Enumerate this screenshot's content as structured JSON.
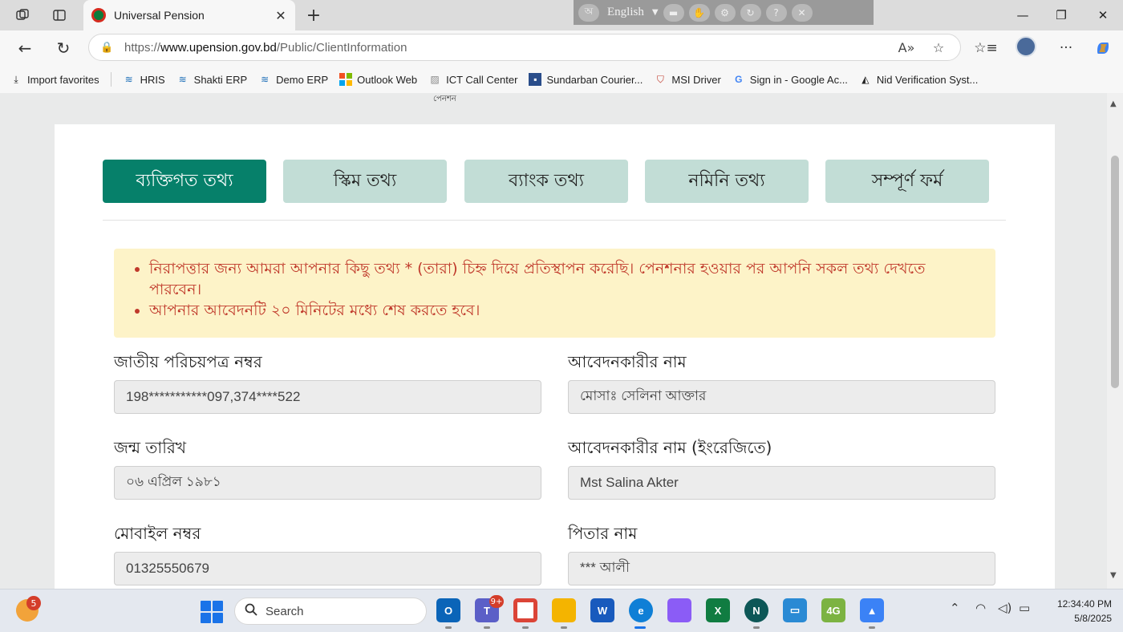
{
  "browser": {
    "tab_title": "Universal Pension",
    "url_host": "www.upension.gov.bd",
    "url_prefix": "https://",
    "url_path": "/Public/ClientInformation",
    "language_toolbar": {
      "language": "English"
    }
  },
  "favorites": [
    {
      "label": "Import favorites",
      "icon": "import-icon"
    },
    {
      "label": "HRIS",
      "icon": "hris-icon"
    },
    {
      "label": "Shakti ERP",
      "icon": "shakti-icon"
    },
    {
      "label": "Demo ERP",
      "icon": "demo-erp-icon"
    },
    {
      "label": "Outlook Web",
      "icon": "microsoft-icon"
    },
    {
      "label": "ICT Call Center",
      "icon": "ict-icon"
    },
    {
      "label": "Sundarban Courier...",
      "icon": "sundarban-icon"
    },
    {
      "label": "MSI Driver",
      "icon": "msi-icon"
    },
    {
      "label": "Sign in - Google Ac...",
      "icon": "google-icon"
    },
    {
      "label": "Nid Verification Syst...",
      "icon": "angular-icon"
    }
  ],
  "page": {
    "top_label": "পেনশন",
    "steps": [
      {
        "label": "ব্যক্তিগত তথ্য",
        "active": true
      },
      {
        "label": "স্কিম তথ্য",
        "active": false
      },
      {
        "label": "ব্যাংক তথ্য",
        "active": false
      },
      {
        "label": "নমিনি তথ্য",
        "active": false
      },
      {
        "label": "সম্পূর্ণ ফর্ম",
        "active": false
      }
    ],
    "notices": [
      "নিরাপত্তার জন্য আমরা আপনার কিছু তথ্য * (তারা) চিহ্ন দিয়ে প্রতিস্থাপন করেছি। পেনশনার হওয়ার পর আপনি সকল তথ্য দেখতে পারবেন।",
      "আপনার আবেদনটি ২০ মিনিটের মধ্যে শেষ করতে হবে।"
    ],
    "fields": {
      "nid": {
        "label": "জাতীয় পরিচয়পত্র নম্বর",
        "value": "198***********097,374****522"
      },
      "applicant_name": {
        "label": "আবেদনকারীর নাম",
        "value": "মোসাঃ সেলিনা আক্তার"
      },
      "dob": {
        "label": "জন্ম তারিখ",
        "value": "০৬ এপ্রিল ১৯৮১"
      },
      "applicant_name_en": {
        "label": "আবেদনকারীর নাম (ইংরেজিতে)",
        "value": "Mst Salina Akter"
      },
      "mobile": {
        "label": "মোবাইল নম্বর",
        "value": "01325550679"
      },
      "father_name": {
        "label": "পিতার নাম",
        "value": "*** আলী"
      }
    }
  },
  "taskbar": {
    "search_placeholder": "Search",
    "weather_badge": "5",
    "teams_badge": "9+",
    "time": "12:34:40 PM",
    "date": "5/8/2025"
  }
}
